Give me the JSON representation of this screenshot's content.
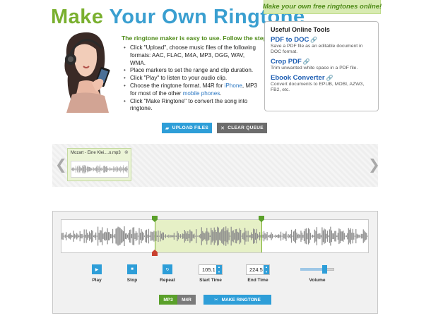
{
  "header": {
    "title_make": "Make",
    "title_rest": "Your Own Ringtone",
    "tagline": "Make your own free ringtones online!"
  },
  "instructions": {
    "intro": "The ringtone maker is easy to use. Follow the steps:",
    "steps": [
      "Click \"Upload\", choose music files of the following formats: AAC, FLAC, M4A, MP3, OGG, WAV, WMA.",
      "Place markers to set the range and clip duration.",
      "Click \"Play\" to listen to your audio clip.",
      "Click \"Make Ringtone\" to convert the song into ringtone."
    ],
    "step_format_a": "Choose the ringtone format. M4R for ",
    "step_format_link1": "iPhone",
    "step_format_b": ", MP3 for most of the other ",
    "step_format_link2": "mobile phones",
    "step_format_c": "."
  },
  "tools": {
    "heading": "Useful Online Tools",
    "items": [
      {
        "name": "PDF to DOC",
        "desc": "Save a PDF file as an editable document in DOC format."
      },
      {
        "name": "Crop PDF",
        "desc": "Trim unwanted white space in a PDF file."
      },
      {
        "name": "Ebook Converter",
        "desc": "Convert documents to EPUB, MOBI, AZW3, FB2, etc."
      }
    ]
  },
  "actions": {
    "upload_label": "UPLOAD FILES",
    "clear_label": "CLEAR QUEUE"
  },
  "queue": {
    "file_name": "Mozart - Eine Klei....o.mp3"
  },
  "editor": {
    "play_label": "Play",
    "stop_label": "Stop",
    "repeat_label": "Repeat",
    "start_time_label": "Start Time",
    "start_time_value": "105.1",
    "end_time_label": "End Time",
    "end_time_value": "224.5",
    "volume_label": "Volume",
    "volume_level": 0.7
  },
  "output": {
    "format_mp3": "MP3",
    "format_m4r": "M4R",
    "selected_format": "MP3",
    "make_label": "MAKE RINGTONE"
  },
  "colors": {
    "green": "#7ab02f",
    "blue": "#3a9fd0",
    "button_blue": "#2e9ed8",
    "selection": "#e6f0c6"
  }
}
